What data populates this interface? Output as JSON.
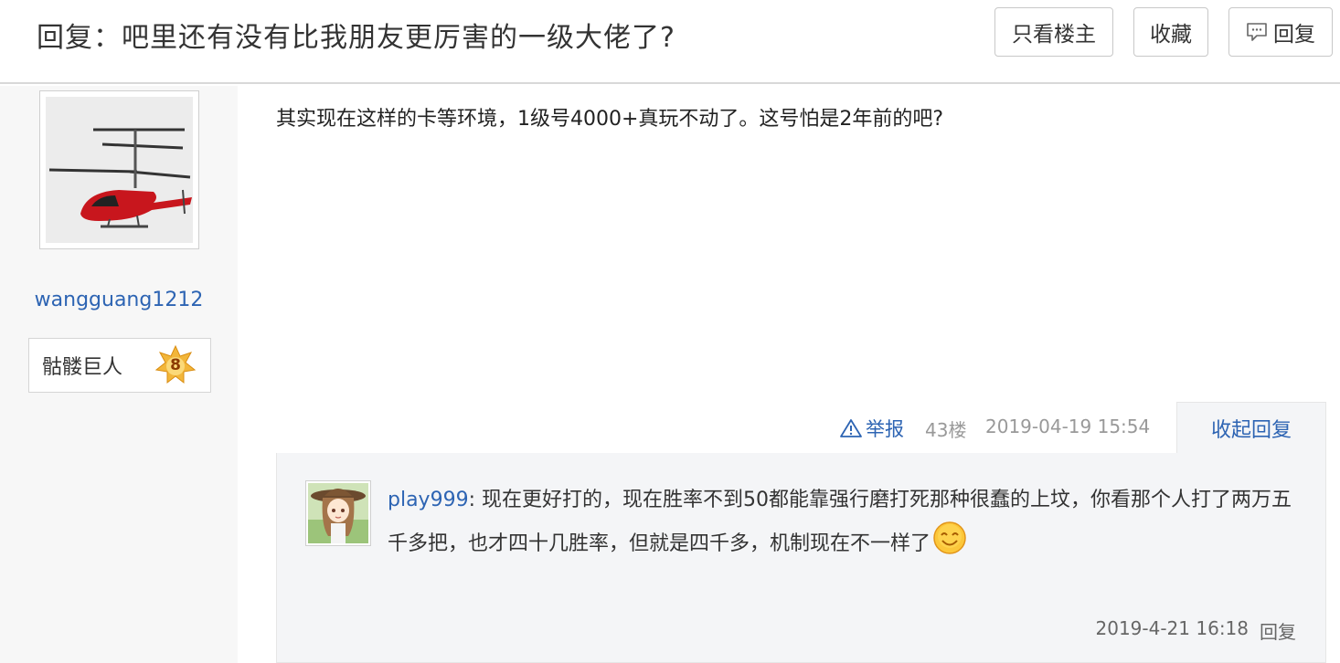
{
  "header": {
    "title": "回复：吧里还有没有比我朋友更厉害的一级大佬了?",
    "btn_only_owner": "只看楼主",
    "btn_favorite": "收藏",
    "btn_reply": "回复"
  },
  "user": {
    "name": "wangguang1212",
    "badge_name": "骷髅巨人",
    "badge_level": "8"
  },
  "post": {
    "text": "其实现在这样的卡等环境，1级号4000+真玩不动了。这号怕是2年前的吧?",
    "report": "举报",
    "floor": "43楼",
    "time": "2019-04-19 15:54",
    "collapse": "收起回复"
  },
  "reply": {
    "user": "play999",
    "text": ": 现在更好打的，现在胜率不到50都能靠强行磨打死那种很蠢的上坟，你看那个人打了两万五千多把，也才四十几胜率，但就是四千多，机制现在不一样了",
    "time": "2019-4-21 16:18",
    "reply_label": "回复"
  },
  "colors": {
    "link": "#2d64b3",
    "meta": "#999999",
    "sidebar": "#f7f7f7",
    "reply_bg": "#f4f5f7"
  },
  "icons": [
    "reply-icon",
    "warning-icon",
    "level-badge-icon",
    "smile-emoji-icon"
  ]
}
